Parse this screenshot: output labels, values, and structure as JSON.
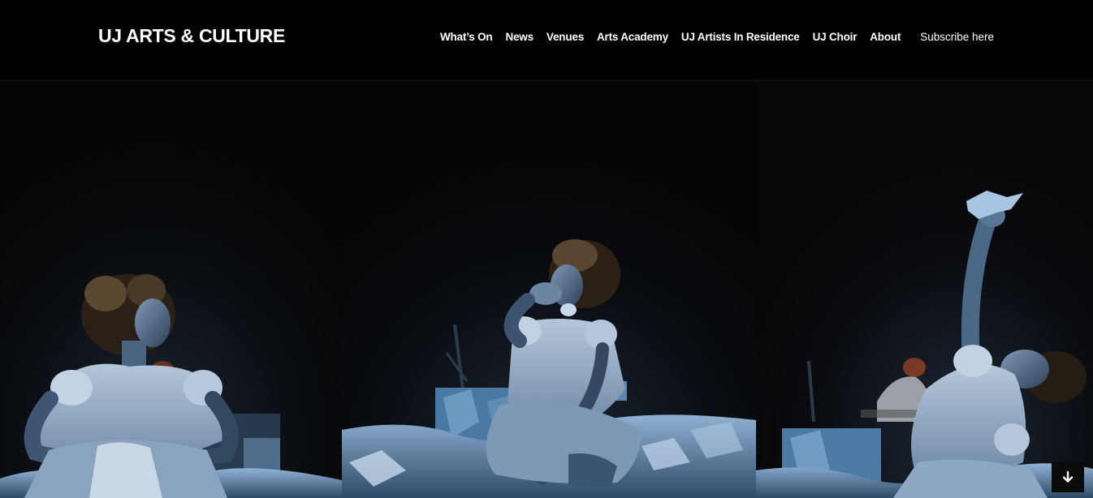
{
  "header": {
    "logo_text": "UJ ARTS & CULTURE",
    "nav_items": [
      {
        "label": "What’s On"
      },
      {
        "label": "News"
      },
      {
        "label": "Venues"
      },
      {
        "label": "Arts Academy"
      },
      {
        "label": "UJ Artists In Residence"
      },
      {
        "label": "UJ Choir"
      },
      {
        "label": "About"
      }
    ],
    "subscribe_label": "Subscribe here"
  },
  "hero": {
    "image_icon": "stage-performance-photo",
    "scroll_icon": "arrow-down-icon"
  },
  "colors": {
    "header_bg": "#000000",
    "text": "#ffffff",
    "stage_blue": "#7fa6c8"
  }
}
